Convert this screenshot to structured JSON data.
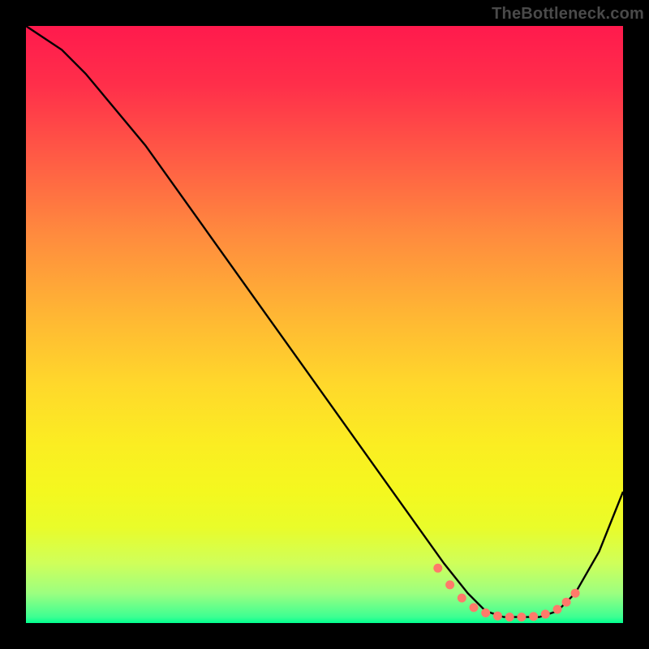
{
  "watermark": {
    "text": "TheBottleneck.com"
  },
  "chart_data": {
    "type": "line",
    "title": "",
    "xlabel": "",
    "ylabel": "",
    "xlim": [
      0,
      100
    ],
    "ylim": [
      0,
      100
    ],
    "series": [
      {
        "name": "curve",
        "x": [
          0,
          6,
          10,
          20,
          30,
          40,
          50,
          60,
          65,
          70,
          74,
          77,
          80,
          83,
          86,
          89,
          92,
          96,
          100
        ],
        "y": [
          100,
          96,
          92,
          80,
          66,
          52,
          38,
          24,
          17,
          10,
          5,
          2,
          1,
          1,
          1,
          2,
          5,
          12,
          22
        ]
      }
    ],
    "markers": {
      "name": "dots",
      "x": [
        69,
        71,
        73,
        75,
        77,
        79,
        81,
        83,
        85,
        87,
        89,
        90.5,
        92
      ],
      "y": [
        9.2,
        6.4,
        4.2,
        2.6,
        1.7,
        1.2,
        1.0,
        1.0,
        1.1,
        1.5,
        2.3,
        3.5,
        5.0
      ]
    },
    "colors": {
      "curve": "#000000",
      "marker": "#ff7a6a"
    }
  }
}
